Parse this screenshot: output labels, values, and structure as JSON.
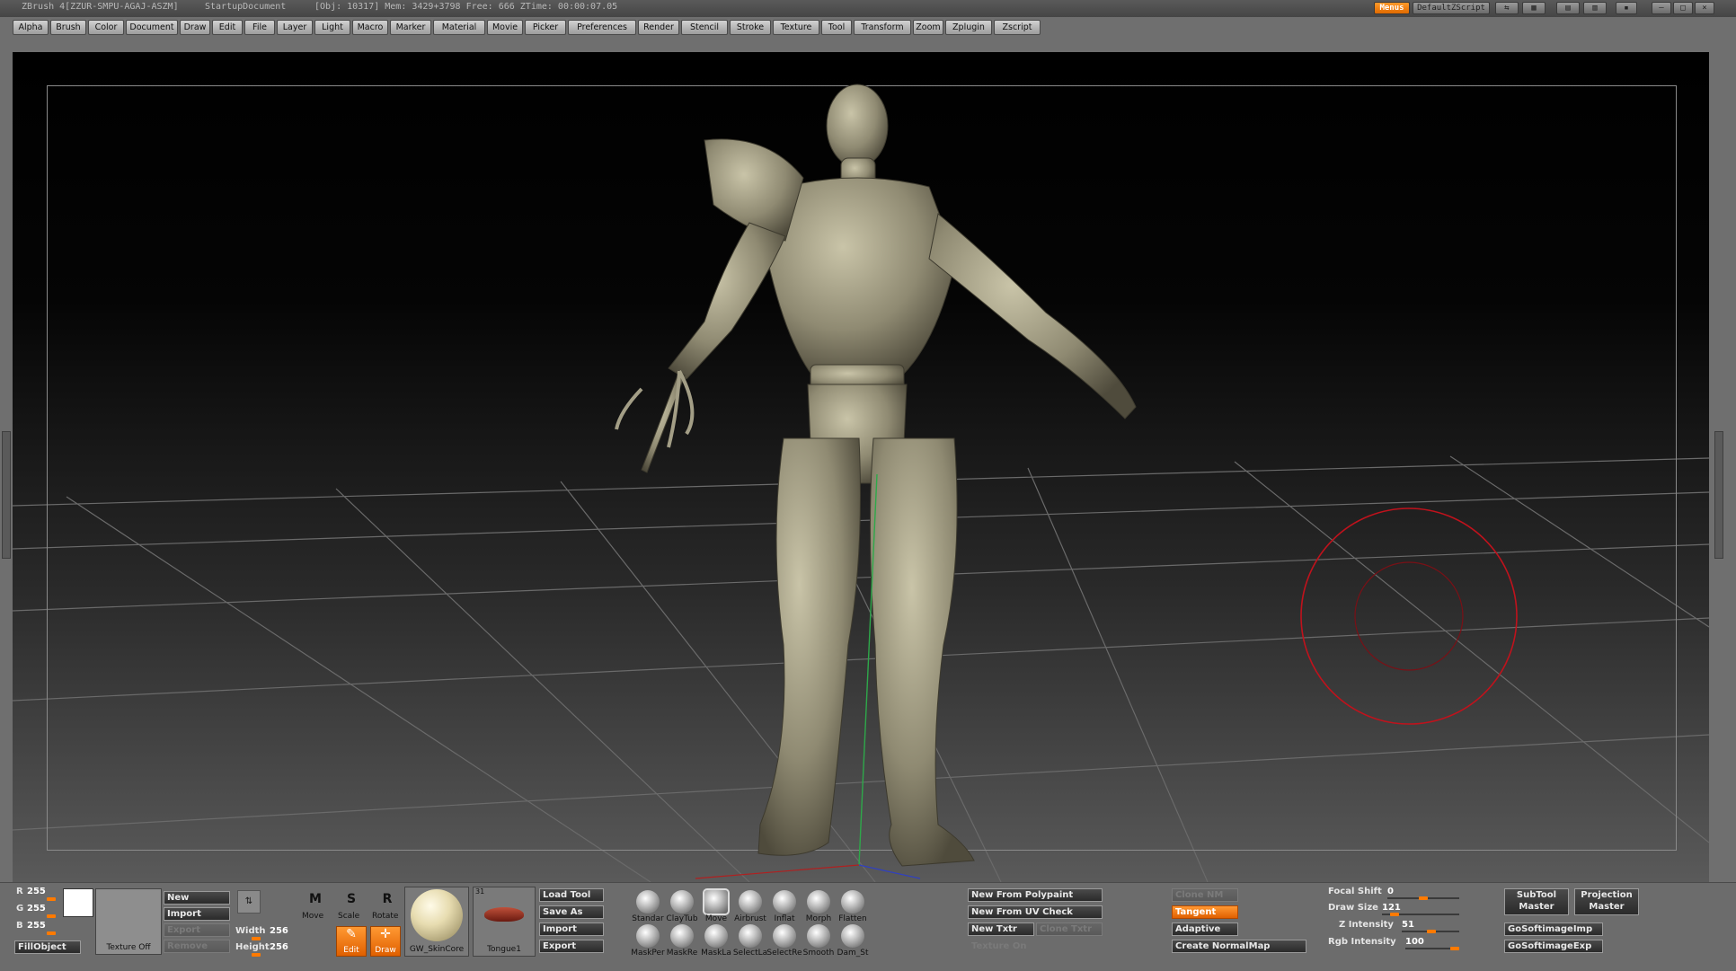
{
  "titlebar": {
    "app": "ZBrush 4[ZZUR-SMPU-AGAJ-ASZM]",
    "document": "StartupDocument",
    "stats": "[Obj: 10317] Mem: 3429+3798 Free: 666 ZTime: 00:00:07.05",
    "menus_toggle": "Menus",
    "script": "DefaultZScript"
  },
  "menubar": [
    "Alpha",
    "Brush",
    "Color",
    "Document",
    "Draw",
    "Edit",
    "File",
    "Layer",
    "Light",
    "Macro",
    "Marker",
    "Material",
    "Movie",
    "Picker",
    "Preferences",
    "Render",
    "Stencil",
    "Stroke",
    "Texture",
    "Tool",
    "Transform",
    "Zoom",
    "Zplugin",
    "Zscript"
  ],
  "colors": {
    "accent": "#ff7a00",
    "brush_circle": "#c0121c",
    "model": "#8f8a72",
    "grid": "#6a6a6a"
  },
  "rgb": {
    "r_label": "R",
    "r": "255",
    "g_label": "G",
    "g": "255",
    "b_label": "B",
    "b": "255",
    "fill": "FillObject"
  },
  "texture": {
    "label": "Texture Off",
    "new": "New",
    "import": "Import",
    "export": "Export",
    "remove": "Remove",
    "width_label": "Width",
    "width": "256",
    "height_label": "Height",
    "height": "256"
  },
  "transform": {
    "move": "Move",
    "scale": "Scale",
    "rotate": "Rotate",
    "edit": "Edit",
    "draw": "Draw"
  },
  "material": {
    "name": "GW_SkinCore"
  },
  "tool": {
    "name": "Tongue1",
    "badge": "31",
    "load": "Load Tool",
    "save": "Save As",
    "import": "Import",
    "export": "Export"
  },
  "brushes": {
    "row1": [
      "Standar",
      "ClayTub",
      "Move",
      "Airbrust",
      "Inflat",
      "Morph",
      "Flatten"
    ],
    "row2": [
      "MaskPer",
      "MaskRe",
      "MaskLa",
      "SelectLa",
      "SelectRe",
      "Smooth",
      "Dam_St"
    ]
  },
  "uv": {
    "polypaint": "New From Polypaint",
    "uvcheck": "New From UV Check",
    "txtr": "New Txtr",
    "clone_txtr": "Clone Txtr",
    "texture_on": "Texture On"
  },
  "normal": {
    "clone": "Clone NM",
    "tangent": "Tangent",
    "adaptive": "Adaptive",
    "create": "Create NormalMap"
  },
  "draw": {
    "focal_label": "Focal Shift",
    "focal": "0",
    "size_label": "Draw Size",
    "size": "121",
    "z_label": "Z Intensity",
    "z": "51",
    "rgb_label": "Rgb Intensity",
    "rgb": "100"
  },
  "plugins": {
    "subtool": "SubTool Master",
    "projection": "Projection Master",
    "imp": "GoSoftimageImp",
    "exp": "GoSoftimageExp"
  }
}
